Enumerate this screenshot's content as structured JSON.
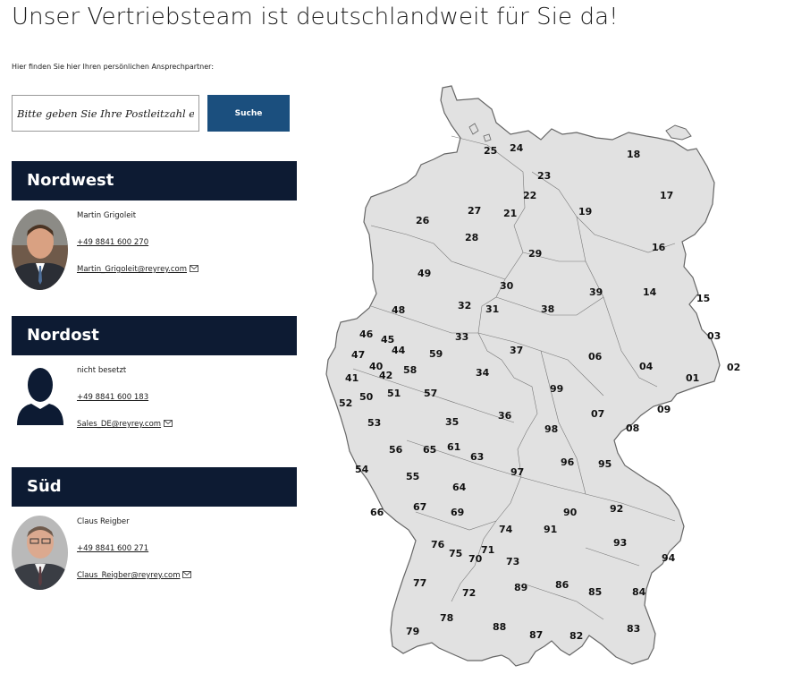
{
  "title": "Unser Vertriebsteam ist deutschlandweit für Sie da!",
  "intro": "Hier finden Sie hier Ihren persönlichen Ansprechpartner:",
  "search": {
    "placeholder": "Bitte geben Sie Ihre Postleitzahl ein",
    "button_label": "Suche"
  },
  "regions": [
    {
      "name": "Nordwest",
      "contact": {
        "name": "Martin Grigoleit",
        "phone": "+49 8841 600 270",
        "email": "Martin_Grigoleit@reyrey.com"
      }
    },
    {
      "name": "Nordost",
      "contact": {
        "name": "nicht besetzt",
        "phone": "+49 8841 600 183",
        "email": "Sales_DE@reyrey.com"
      }
    },
    {
      "name": "Süd",
      "contact": {
        "name": "Claus Reigber",
        "phone": "+49 8841 600 271",
        "email": "Claus_Reigber@reyrey.com"
      }
    }
  ],
  "map": {
    "postal_zones": [
      "01",
      "02",
      "03",
      "04",
      "06",
      "07",
      "08",
      "09",
      "14",
      "15",
      "16",
      "17",
      "18",
      "19",
      "21",
      "22",
      "23",
      "24",
      "25",
      "26",
      "27",
      "28",
      "29",
      "30",
      "31",
      "32",
      "33",
      "34",
      "35",
      "36",
      "37",
      "38",
      "39",
      "40",
      "41",
      "42",
      "44",
      "45",
      "46",
      "47",
      "48",
      "49",
      "50",
      "51",
      "52",
      "53",
      "54",
      "55",
      "56",
      "57",
      "58",
      "59",
      "61",
      "63",
      "64",
      "65",
      "66",
      "67",
      "69",
      "70",
      "71",
      "72",
      "73",
      "74",
      "75",
      "76",
      "77",
      "78",
      "79",
      "82",
      "83",
      "84",
      "85",
      "86",
      "87",
      "88",
      "89",
      "90",
      "91",
      "92",
      "93",
      "94",
      "95",
      "96",
      "97",
      "98",
      "99"
    ]
  },
  "colors": {
    "header_bg": "#0d1b33",
    "button_bg": "#1b4f7e",
    "map_fill": "#e1e1e1",
    "map_stroke": "#666666"
  }
}
